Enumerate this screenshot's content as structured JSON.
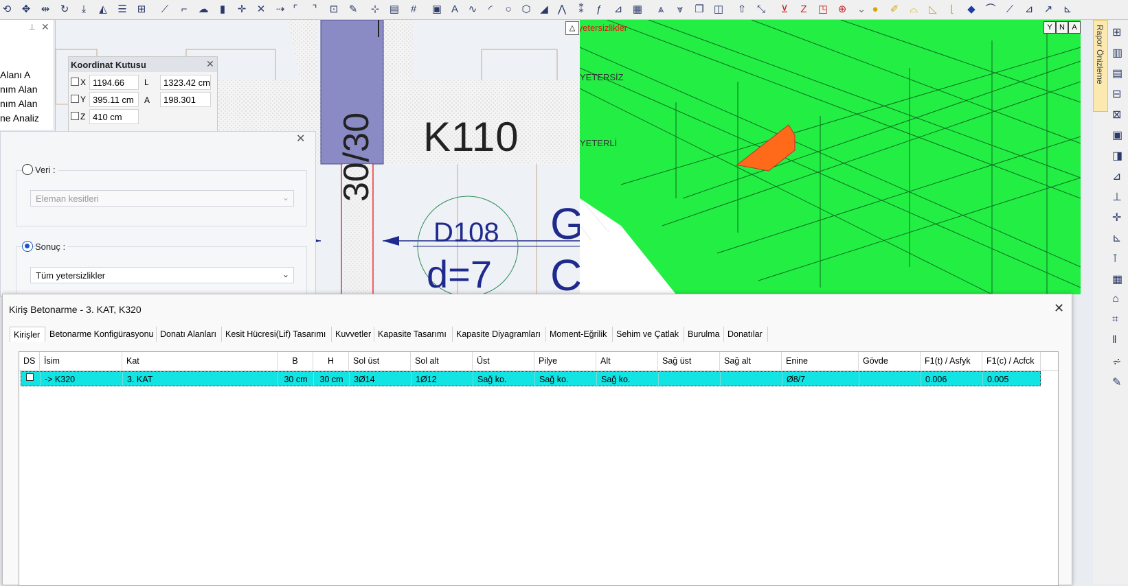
{
  "colors": {
    "accent_row": "#12e3e3",
    "green": "#22ee44",
    "red": "#ee1111",
    "orange": "#ff6a1a",
    "cad_blue": "#1e2a8c"
  },
  "left_panel": {
    "lines": [
      "Alanı A",
      "nım Alan",
      "nım Alan",
      "ne Analiz"
    ]
  },
  "cad": {
    "column_label": "K110",
    "beam_size": "30/30",
    "slab_label": "D108",
    "slab_thickness": "d=7",
    "partial_right_1": "G",
    "partial_right_2": "C"
  },
  "coord_box": {
    "title": "Koordinat Kutusu",
    "x_label": "X",
    "x_value": "1194.66 cm",
    "y_label": "Y",
    "y_value": "395.11 cm",
    "z_label": "Z",
    "z_value": "410 cm",
    "l_label": "L",
    "l_value": "1323.42 cm",
    "a_label": "A",
    "a_value": "198.301"
  },
  "filter_dialog": {
    "veri_label": "Veri :",
    "veri_select": "Eleman kesitleri",
    "sonuc_label": "Sonuç :",
    "sonuc_select": "Tüm yetersizlikler"
  },
  "view3d": {
    "legend_title": "Tüm yetersizlikler",
    "legend_yetersiz": "YETERSİZ",
    "legend_yeterli": "YETERLİ",
    "buttons": [
      "Y",
      "N",
      "A"
    ]
  },
  "right_sidebar": {
    "vertical_tab": "Rapor Önizleme"
  },
  "main_dialog": {
    "title": "Kiriş Betonarme - 3. KAT, K320",
    "tabs": [
      "Kirişler",
      "Betonarme Konfigürasyonu",
      "Donatı Alanları",
      "Kesit Hücresi(Lif) Tasarımı",
      "Kuvvetler",
      "Kapasite Tasarımı",
      "Kapasite Diyagramları",
      "Moment-Eğrilik",
      "Sehim ve Çatlak",
      "Burulma",
      "Donatılar"
    ],
    "columns": [
      "DS",
      "İsim",
      "Kat",
      "B",
      "H",
      "Sol üst",
      "Sol alt",
      "Üst",
      "Pilye",
      "Alt",
      "Sağ üst",
      "Sağ alt",
      "Enine",
      "Gövde",
      "F1(t) / Asfyk",
      "F1(c) / Acfck"
    ],
    "row": [
      "",
      "-> K320",
      "3. KAT",
      "30 cm",
      "30 cm",
      "3Ø14",
      "1Ø12",
      "Sağ ko.",
      "Sağ ko.",
      "Sağ ko.",
      "",
      "",
      "Ø8/7",
      "",
      "0.006",
      "0.005"
    ]
  }
}
